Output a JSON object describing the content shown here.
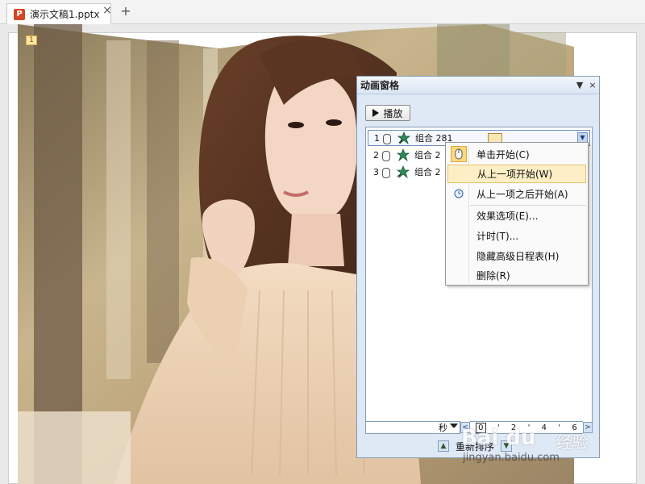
{
  "tab": {
    "icon_label": "P",
    "title": "演示文稿1.pptx",
    "close": "×",
    "add": "+"
  },
  "slide": {
    "anim_badge": "1"
  },
  "pane": {
    "title": "动画窗格",
    "dropdown_glyph": "▼",
    "close_glyph": "×",
    "play_label": "播放",
    "rows": [
      {
        "number": "1",
        "label": "组合 281"
      },
      {
        "number": "2",
        "label": "组合 2"
      },
      {
        "number": "3",
        "label": "组合 2"
      }
    ],
    "row_dropdown_glyph": "▼",
    "timeline": {
      "unit": "秒",
      "left_arrow": "<",
      "right_arrow": ">",
      "ticks": [
        "0",
        "'",
        "2",
        "'",
        "4",
        "'",
        "6"
      ]
    },
    "reorder_label": "重新排序",
    "reorder_up": "▲",
    "reorder_down": "▼"
  },
  "menu": {
    "items": [
      {
        "label": "单击开始(C)",
        "icon": "mouse-click-icon"
      },
      {
        "label": "从上一项开始(W)",
        "icon": ""
      },
      {
        "label": "从上一项之后开始(A)",
        "icon": "clock-icon"
      },
      {
        "label": "效果选项(E)...",
        "icon": ""
      },
      {
        "label": "计时(T)...",
        "icon": ""
      },
      {
        "label": "隐藏高级日程表(H)",
        "icon": ""
      },
      {
        "label": "删除(R)",
        "icon": ""
      }
    ]
  },
  "watermark": {
    "brand": "Bai du",
    "cn": "经验",
    "url": "jingyan.baidu.com"
  },
  "colors": {
    "pane_bg": "#dfe8f5",
    "menu_highlight": "#fcefc6",
    "ppt_icon": "#d24726"
  }
}
